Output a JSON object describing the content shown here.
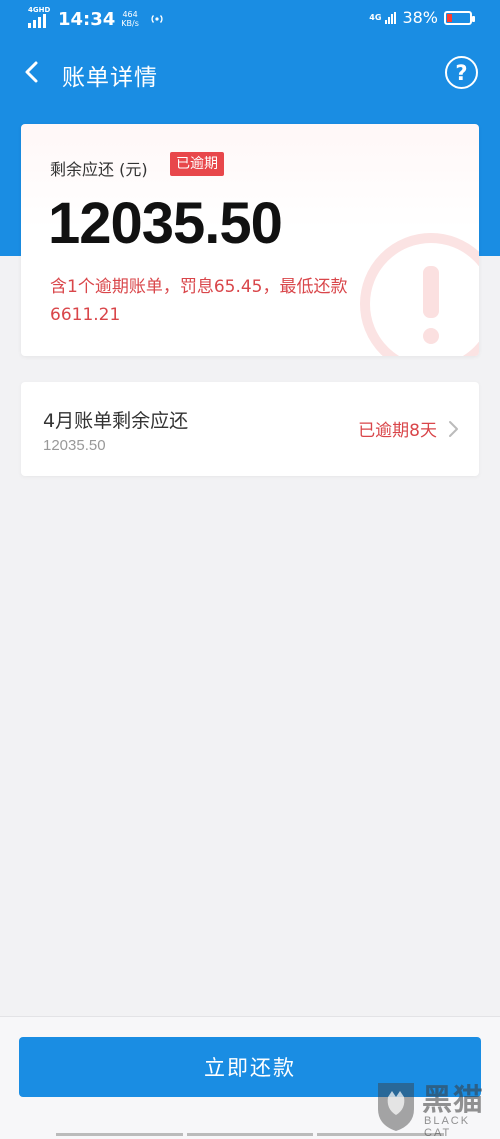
{
  "status_bar": {
    "network": "4GHD",
    "time": "14:34",
    "speed_value": "464",
    "speed_unit": "KB/s",
    "network_right": "4G",
    "battery": "38%"
  },
  "header": {
    "title": "账单详情",
    "help_label": "?"
  },
  "summary": {
    "label": "剩余应还 (元)",
    "status_tag": "已逾期",
    "amount": "12035.50",
    "note": "含1个逾期账单，罚息65.45，最低还款6611.21"
  },
  "bills": [
    {
      "title": "4月账单剩余应还",
      "amount": "12035.50",
      "status": "已逾期8天"
    }
  ],
  "footer": {
    "pay_button_label": "立即还款"
  },
  "watermark": {
    "name": "黑猫",
    "subtitle": "BLACK CAT"
  },
  "colors": {
    "brand_blue": "#1a8de3",
    "overdue_red": "#d9464a"
  }
}
